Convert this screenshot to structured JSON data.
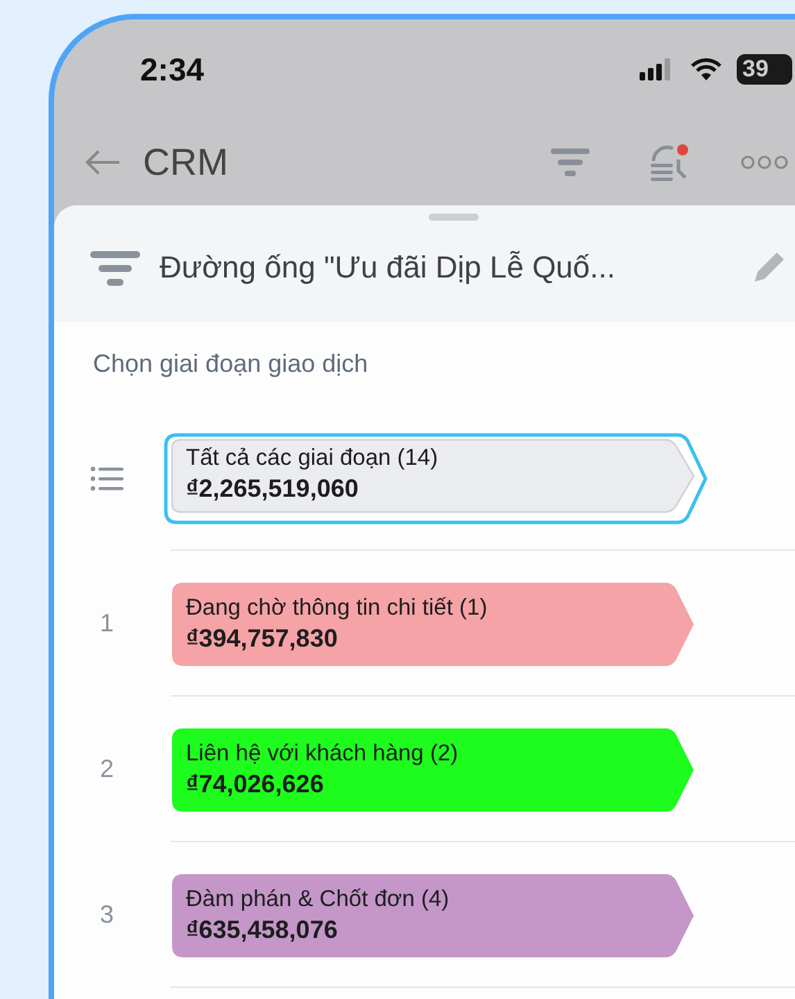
{
  "status_bar": {
    "time": "2:34",
    "battery": "39"
  },
  "nav": {
    "title": "CRM",
    "activity_alert": true
  },
  "sheet": {
    "title": "Đường ống \"Ưu đãi Dịp Lễ Quố...",
    "prompt": "Chọn giai đoạn giao dịch",
    "stages": [
      {
        "kind": "all",
        "label": "Tất cả các giai đoạn (14)",
        "amount": "₫2,265,519,060",
        "color": "#ebecf0",
        "selected": true
      },
      {
        "kind": "stage",
        "index": "1",
        "label": "Đang chờ thông tin chi tiết (1)",
        "amount": "₫394,757,830",
        "color": "#f5a3a6",
        "selected": false
      },
      {
        "kind": "stage",
        "index": "2",
        "label": "Liên hệ với khách hàng (2)",
        "amount": "₫74,026,626",
        "color": "#1dfc1c",
        "selected": false
      },
      {
        "kind": "stage",
        "index": "3",
        "label": "Đàm phán & Chốt đơn (4)",
        "amount": "₫635,458,076",
        "color": "#c497c8",
        "selected": false
      }
    ]
  }
}
